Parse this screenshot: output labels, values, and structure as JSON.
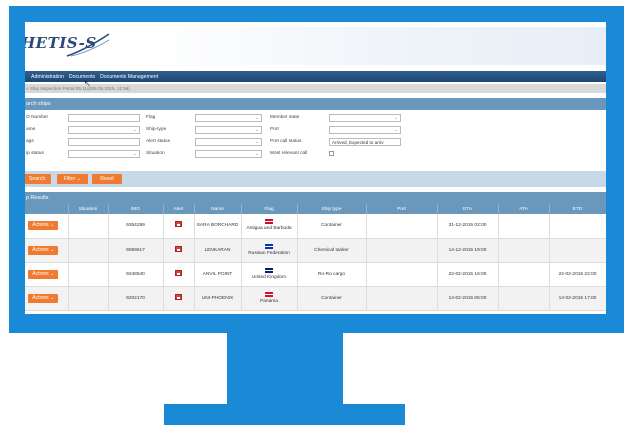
{
  "app": {
    "logo_text": "HETIS-S"
  },
  "menu": [
    "Administration",
    "Documents",
    "Documents Management"
  ],
  "breadcrumb": "» Ship Inspection Portal 05.11@06.05.2015, 11:56)",
  "search": {
    "title": "arch ships",
    "fields": {
      "imo": {
        "label": "O Number",
        "value": ""
      },
      "name": {
        "label": "ame",
        "value": ""
      },
      "calls": {
        "label": "ags",
        "value": ""
      },
      "ship_status": {
        "label": "ip status",
        "value": ""
      },
      "flag": {
        "label": "Flag",
        "value": ""
      },
      "ship_type": {
        "label": "Ship-type",
        "value": ""
      },
      "alert_status": {
        "label": "Alert status",
        "value": ""
      },
      "situation": {
        "label": "Situation",
        "value": ""
      },
      "member_state": {
        "label": "Member state",
        "value": ""
      },
      "port": {
        "label": "Port",
        "value": ""
      },
      "port_call_status": {
        "label": "Port call status",
        "value": "Arrived, Expected to arriv"
      },
      "most_relevant_call": {
        "label": "Most relevant call"
      }
    },
    "buttons": {
      "search": "Search",
      "filter": "Filter",
      "reset": "Reset"
    }
  },
  "results": {
    "title": "p Results",
    "columns": [
      "",
      "Situation",
      "IMO",
      "Alert",
      "Name",
      "Flag",
      "Ship type",
      "Port",
      "ETA",
      "ATA",
      "ETD"
    ],
    "actions_label": "Actions",
    "rows": [
      {
        "imo": "9354299",
        "name": "SARA BORCHARD",
        "flag": "Antigua and Barbuda",
        "flag_color": "#c8102e",
        "ship_type": "Container",
        "port": "",
        "eta": "31-12-2015 02:00",
        "ata": "",
        "etd": ""
      },
      {
        "imo": "9069617",
        "name": "LENKARAN",
        "flag": "Russian Federation",
        "flag_color": "#0039a6",
        "ship_type": "Chemical tanker",
        "port": "",
        "eta": "14-12-2015 19:00",
        "ata": "",
        "etd": ""
      },
      {
        "imo": "9248540",
        "name": "ANVIL POINT",
        "flag": "United Kingdom",
        "flag_color": "#012169",
        "ship_type": "Ro-Ro cargo",
        "port": "",
        "eta": "22-02-2015 16:00",
        "ata": "",
        "etd": "22-02-2015 22:00"
      },
      {
        "imo": "9202170",
        "name": "UNI-PHOENIX",
        "flag": "Panama",
        "flag_color": "#d21034",
        "ship_type": "Container",
        "port": "",
        "eta": "14-02-2015 06:00",
        "ata": "",
        "etd": "14-02-2015 17:00"
      }
    ]
  },
  "colors": {
    "monitor": "#1a8ad6",
    "accent": "#f07a30",
    "header": "#6a98bd",
    "menubar": "#1e4672"
  }
}
